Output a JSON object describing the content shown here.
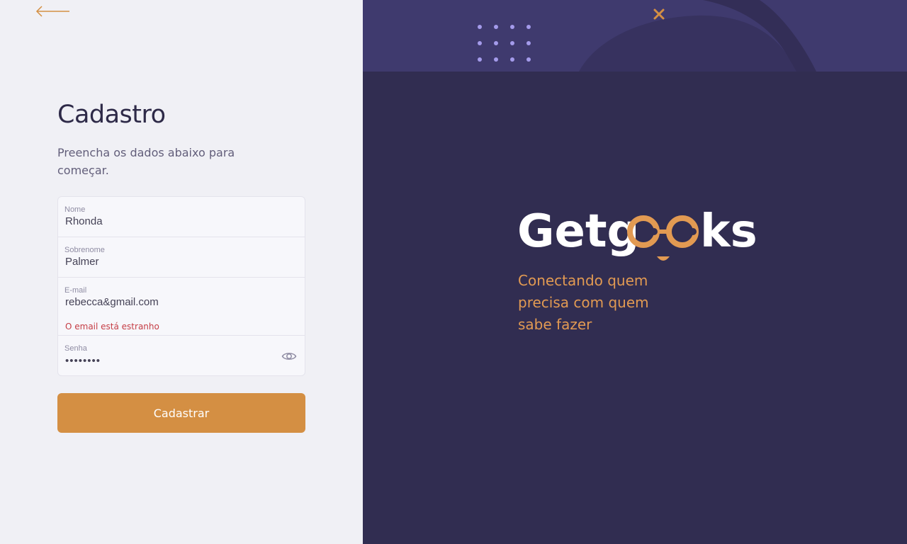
{
  "page": {
    "title": "Cadastro",
    "subtitle": "Preencha os dados abaixo para começar."
  },
  "form": {
    "nome": {
      "label": "Nome",
      "value": "Rhonda"
    },
    "sobrenome": {
      "label": "Sobrenome",
      "value": "Palmer"
    },
    "email": {
      "label": "E-mail",
      "value": "rebecca&gmail.com",
      "error": "O email está estranho"
    },
    "senha": {
      "label": "Senha",
      "value": "••••••••"
    },
    "submit_label": "Cadastrar"
  },
  "brand": {
    "name": "Getgeeks",
    "logo_prefix": "Getg",
    "logo_suffix": "ks",
    "tagline": "Conectando quem precisa com quem sabe fazer"
  },
  "icons": {
    "back": "arrow-left-icon",
    "close": "close-icon",
    "eye": "eye-icon"
  },
  "colors": {
    "accent": "#D48F43",
    "dark_panel": "#312D51",
    "panel_top": "#3F3A6E",
    "error": "#C53D45",
    "dots": "#A49BEB"
  }
}
